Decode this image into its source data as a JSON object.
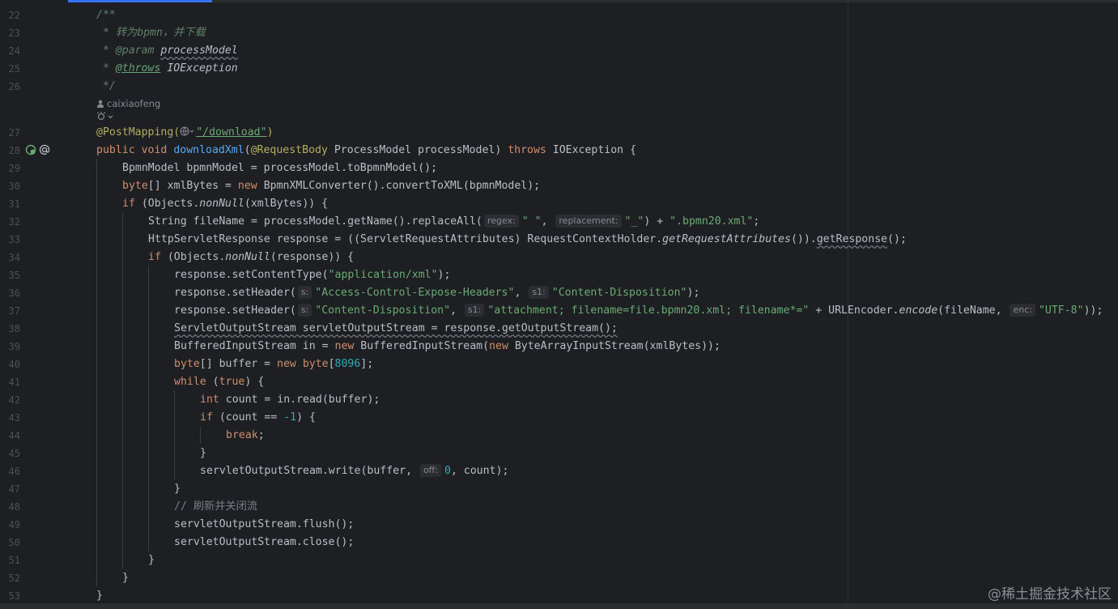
{
  "editor": {
    "accent_color": "#3574f0",
    "background": "#1e1f22",
    "scroll_progress_fraction": 0.19
  },
  "line_numbers": [
    "22",
    "23",
    "24",
    "25",
    "26",
    "27",
    "28",
    "29",
    "30",
    "31",
    "32",
    "33",
    "34",
    "35",
    "36",
    "37",
    "38",
    "39",
    "40",
    "41",
    "42",
    "43",
    "44",
    "45",
    "46",
    "47",
    "48",
    "49",
    "50",
    "51",
    "52",
    "53"
  ],
  "doc_comment": {
    "open": "/**",
    "desc": " * 转为bpmn，并下载",
    "param_prefix": " * ",
    "param_tag": "@param",
    "param_name": "processModel",
    "throws_prefix": " * ",
    "throws_tag": "@throws",
    "throws_name": "IOException",
    "close": " */"
  },
  "author_hint": "caixiaofeng",
  "author_icon": "person-icon",
  "lens_icon": "code-lens-icon",
  "code": {
    "l27_ann": "@PostMapping(",
    "l27_url": "\"/download\"",
    "l27_close": ")",
    "l28_public": "public",
    "l28_void": "void",
    "l28_method": "downloadXml",
    "l28_paren": "(",
    "l28_ann": "@RequestBody",
    "l28_rest": " ProcessModel processModel) ",
    "l28_throws": "throws",
    "l28_end": " IOException {",
    "l29": "BpmnModel bpmnModel = processModel.toBpmnModel();",
    "l30_type": "byte",
    "l30_a": "[] xmlBytes = ",
    "l30_new": "new",
    "l30_b": " BpmnXMLConverter().convertToXML(bpmnModel);",
    "l31_if": "if",
    "l31_a": " (Objects.",
    "l31_it": "nonNull",
    "l31_b": "(xmlBytes)) {",
    "l32_a": "String fileName = processModel.getName().replaceAll(",
    "l32_hint1": "regex:",
    "l32_s1": "\" \"",
    "l32_comma": ", ",
    "l32_hint2": "replacement:",
    "l32_s2": "\"_\"",
    "l32_b": ") + ",
    "l32_s3": "\".bpmn20.xml\"",
    "l32_end": ";",
    "l33_a": "HttpServletResponse response = ((ServletRequestAttributes) RequestContextHolder.",
    "l33_it": "getRequestAttributes",
    "l33_b": "()).",
    "l33_wavy": "getResponse",
    "l33_c": "();",
    "l34_if": "if",
    "l34_a": " (Objects.",
    "l34_it": "nonNull",
    "l34_b": "(response)) {",
    "l35_a": "response.setContentType(",
    "l35_s": "\"application/xml\"",
    "l35_b": ");",
    "l36_a": "response.setHeader(",
    "l36_hint1": "s:",
    "l36_s1": "\"Access-Control-Expose-Headers\"",
    "l36_comma": ", ",
    "l36_hint2": "s1:",
    "l36_s2": "\"Content-Disposition\"",
    "l36_b": ");",
    "l37_a": "response.setHeader(",
    "l37_hint1": "s:",
    "l37_s1": "\"Content-Disposition\"",
    "l37_comma": ", ",
    "l37_hint2": "s1:",
    "l37_s2": "\"attachment; filename=file.bpmn20.xml; filename*=\"",
    "l37_b": " + URLEncoder.",
    "l37_it": "encode",
    "l37_c": "(fileName, ",
    "l37_hint3": "enc:",
    "l37_s3": "\"UTF-8\"",
    "l37_d": "));",
    "l38": "ServletOutputStream servletOutputStream = response.getOutputStream();",
    "l39_a": "BufferedInputStream in = ",
    "l39_new1": "new",
    "l39_b": " BufferedInputStream(",
    "l39_new2": "new",
    "l39_c": " ByteArrayInputStream(xmlBytes));",
    "l40_type": "byte",
    "l40_a": "[] buffer = ",
    "l40_new": "new",
    "l40_type2": " byte",
    "l40_b": "[",
    "l40_num": "8096",
    "l40_c": "];",
    "l41_while": "while",
    "l41_a": " (",
    "l41_true": "true",
    "l41_b": ") {",
    "l42_int": "int",
    "l42_a": " count = in.read(buffer);",
    "l43_if": "if",
    "l43_a": " (count == ",
    "l43_num": "-1",
    "l43_b": ") {",
    "l44_break": "break",
    "l44_a": ";",
    "l45": "}",
    "l46_a": "servletOutputStream.write(buffer, ",
    "l46_hint": "off:",
    "l46_num": "0",
    "l46_b": ", count);",
    "l47": "}",
    "l48": "// 刷新并关闭流",
    "l49": "servletOutputStream.flush();",
    "l50": "servletOutputStream.close();",
    "l51": "}",
    "l52": "}",
    "l53": "}"
  },
  "gutter": {
    "run_icon": "endpoint-run-icon",
    "at_icon": "at-sign-icon"
  },
  "watermark": "@稀土掘金技术社区"
}
